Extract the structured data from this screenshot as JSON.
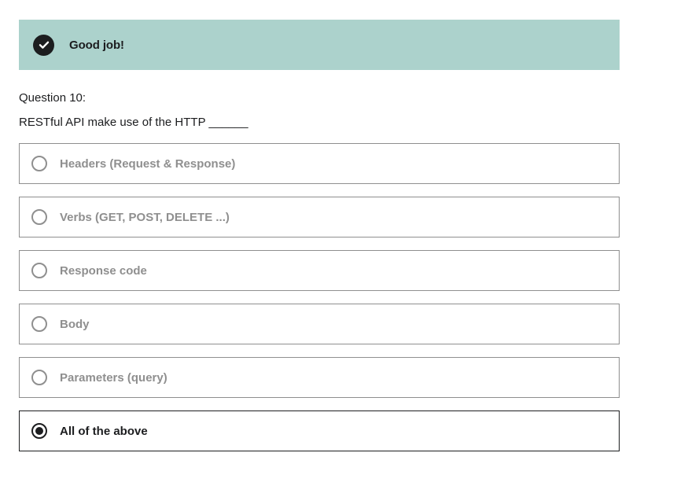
{
  "alert": {
    "icon": "checkmark-circle-icon",
    "message": "Good job!",
    "background": "#acd2cc"
  },
  "question": {
    "number": "Question 10:",
    "text": "RESTful API make use of the HTTP ______"
  },
  "options": [
    {
      "label": "Headers (Request & Response)",
      "selected": false
    },
    {
      "label": "Verbs (GET, POST, DELETE ...)",
      "selected": false
    },
    {
      "label": "Response code",
      "selected": false
    },
    {
      "label": "Body",
      "selected": false
    },
    {
      "label": "Parameters (query)",
      "selected": false
    },
    {
      "label": "All of the above",
      "selected": true
    }
  ],
  "colors": {
    "text": "#1c1d1f",
    "muted": "#8f8f8f"
  }
}
